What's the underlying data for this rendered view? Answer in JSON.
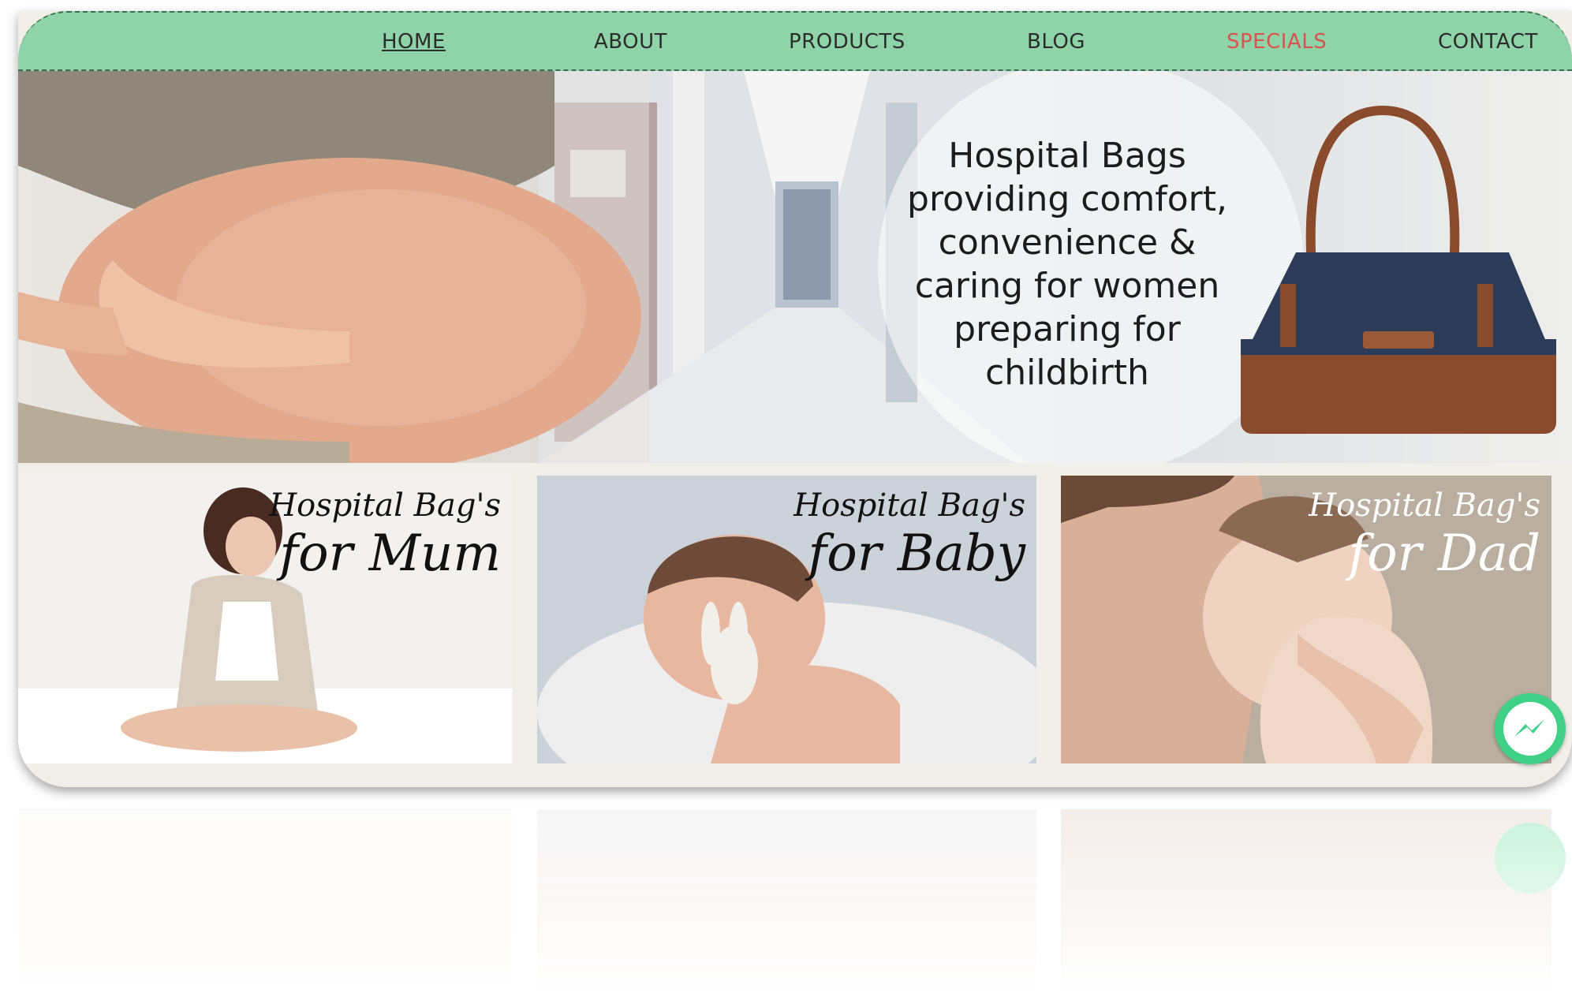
{
  "nav": {
    "items": [
      {
        "label": "HOME"
      },
      {
        "label": "ABOUT"
      },
      {
        "label": "PRODUCTS"
      },
      {
        "label": "BLOG"
      },
      {
        "label": "SPECIALS"
      },
      {
        "label": "CONTACT"
      }
    ]
  },
  "hero": {
    "lines": [
      "Hospital Bags",
      "providing comfort,",
      "convenience &",
      "caring for women",
      "preparing for",
      "childbirth"
    ]
  },
  "cards": [
    {
      "line1": "Hospital Bag's",
      "line2": "for Mum"
    },
    {
      "line1": "Hospital Bag's",
      "line2": "for Baby"
    },
    {
      "line1": "Hospital Bag's",
      "line2": "for Dad"
    }
  ],
  "colors": {
    "nav_background": "#8fd4a8",
    "specials_accent": "#d9534f",
    "messenger_green": "#3fd187"
  },
  "icons": [
    "messenger-icon"
  ]
}
